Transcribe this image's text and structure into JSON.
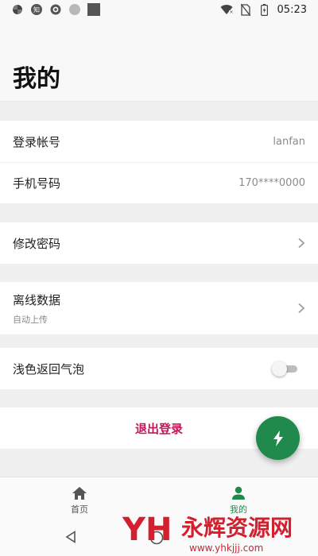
{
  "status_bar": {
    "time": "05:23",
    "icons": [
      "pinwheel-icon",
      "zhihu-icon",
      "app-icon",
      "gray-circle-icon",
      "square-icon",
      "wifi-icon",
      "no-sim-icon",
      "battery-charging-icon"
    ],
    "zhihu_glyph": "知"
  },
  "header": {
    "title": "我的"
  },
  "account": {
    "login_label": "登录帐号",
    "login_value": "lanfan",
    "phone_label": "手机号码",
    "phone_value": "170****0000"
  },
  "settings": {
    "change_password_label": "修改密码",
    "offline_data_label": "离线数据",
    "offline_data_sub": "自动上传",
    "light_bubble_label": "浅色返回气泡",
    "light_bubble_on": false
  },
  "logout": {
    "label": "退出登录"
  },
  "fab": {
    "icon": "lightning-icon",
    "color": "#1f8a4c"
  },
  "bottom_nav": {
    "items": [
      {
        "label": "首页",
        "icon": "home-icon",
        "active": false
      },
      {
        "label": "我的",
        "icon": "person-icon",
        "active": true
      }
    ]
  },
  "watermark": {
    "text": "永辉资源网",
    "url": "www.yhkjjj.com"
  },
  "colors": {
    "accent": "#1f8a4c",
    "logout": "#c2185b",
    "background": "#f0f0f0"
  }
}
